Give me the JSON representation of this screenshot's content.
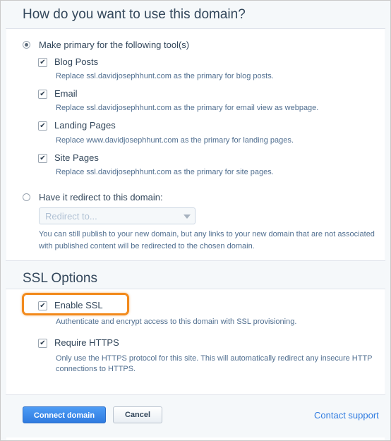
{
  "usage_section": {
    "title": "How do you want to use this domain?",
    "primary_option": {
      "label": "Make primary for the following tool(s)",
      "selected": true,
      "tools": [
        {
          "label": "Blog Posts",
          "checked": true,
          "description": "Replace ssl.davidjosephhunt.com as the primary for blog posts."
        },
        {
          "label": "Email",
          "checked": true,
          "description": "Replace ssl.davidjosephhunt.com as the primary for email view as webpage."
        },
        {
          "label": "Landing Pages",
          "checked": true,
          "description": "Replace www.davidjosephhunt.com as the primary for landing pages."
        },
        {
          "label": "Site Pages",
          "checked": true,
          "description": "Replace ssl.davidjosephhunt.com as the primary for site pages."
        }
      ]
    },
    "redirect_option": {
      "label": "Have it redirect to this domain:",
      "selected": false,
      "select_placeholder": "Redirect to...",
      "help_line1": "You can still publish to your new domain, but any links to your new domain that are not associated",
      "help_line2": "with published content will be redirected to the chosen domain."
    }
  },
  "ssl_section": {
    "title": "SSL Options",
    "enable_ssl": {
      "label": "Enable SSL",
      "checked": true,
      "description": "Authenticate and encrypt access to this domain with SSL provisioning."
    },
    "require_https": {
      "label": "Require HTTPS",
      "checked": true,
      "description_line1": "Only use the HTTPS protocol for this site. This will automatically redirect any insecure HTTP",
      "description_line2": "connections to HTTPS."
    }
  },
  "footer": {
    "connect_label": "Connect domain",
    "cancel_label": "Cancel",
    "support_link": "Contact support"
  },
  "colors": {
    "primary_button": "#2f7be0",
    "highlight": "#f28a1c",
    "link": "#2f7be0"
  }
}
